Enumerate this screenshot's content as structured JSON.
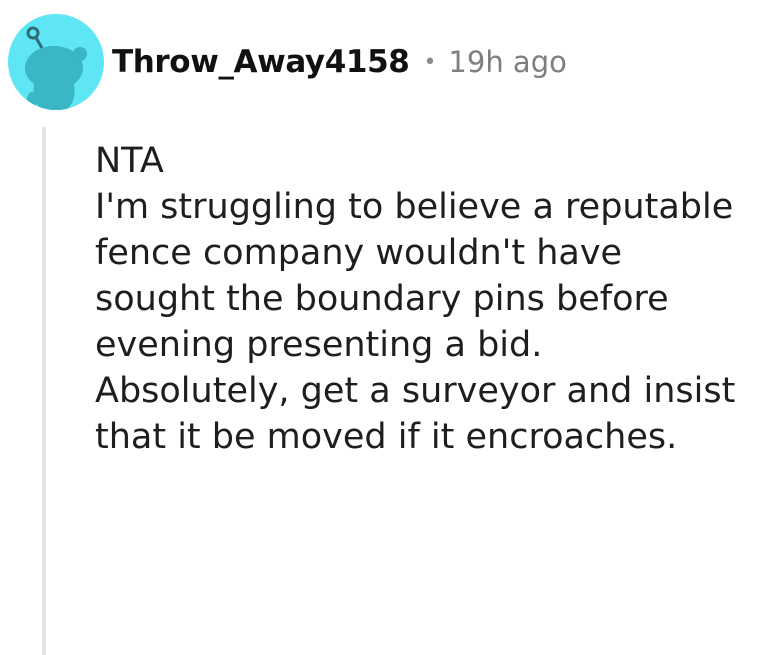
{
  "comment": {
    "username": "Throw_Away4158",
    "separator": "•",
    "timestamp": "19h ago",
    "avatar_icon": "snoo-avatar-icon",
    "avatar_color": "#5ee6f4",
    "paragraphs": [
      "NTA",
      "I'm struggling to believe a reputable fence company wouldn't have sought the boundary pins before evening presenting a bid.",
      "Absolutely, get a surveyor and insist that it be moved if it encroaches."
    ]
  }
}
